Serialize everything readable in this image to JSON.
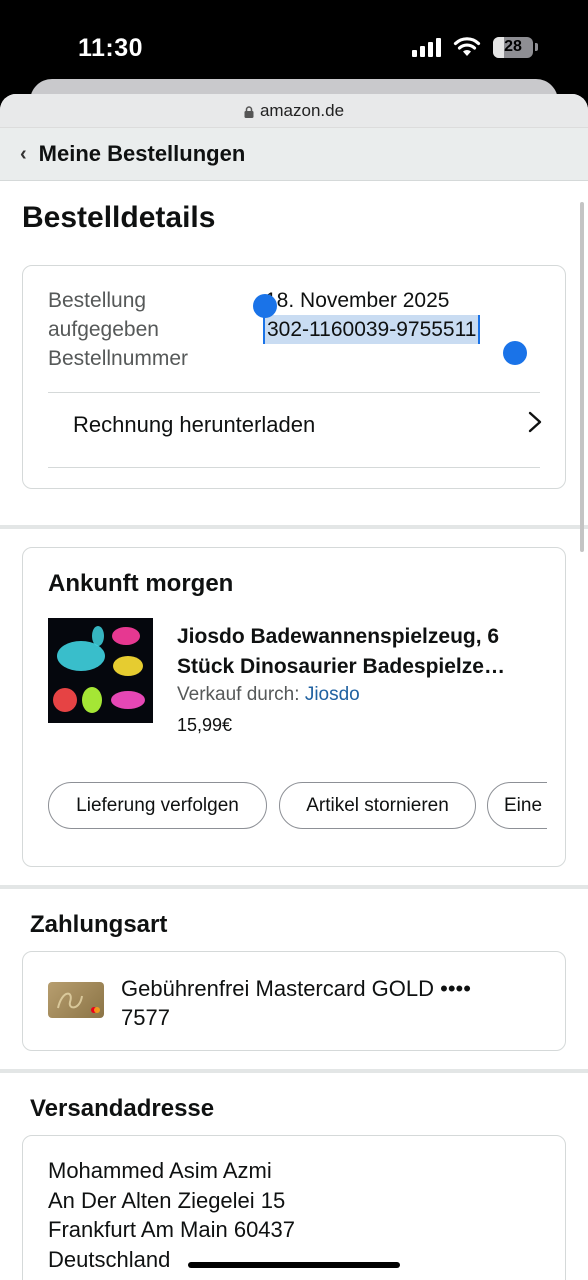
{
  "status": {
    "time": "11:30",
    "battery": "28",
    "battery_level": 0.28
  },
  "browser": {
    "url": "amazon.de"
  },
  "nav": {
    "back_label": "Meine Bestellungen"
  },
  "page_title": "Bestelldetails",
  "order": {
    "placed_label": "Bestellung aufgegeben",
    "number_label": "Bestellnummer",
    "placed_date": "18. November 2025",
    "order_number": "302-1160039-9755511",
    "invoice_label": "Rechnung herunterladen"
  },
  "shipment": {
    "title": "Ankunft morgen",
    "product_line1": "Jiosdo Badewannenspielzeug, 6",
    "product_line2": "Stück Dinosaurier Badespielze…",
    "sold_by_label": "Verkauf durch:",
    "seller": "Jiosdo",
    "price": "15,99€",
    "buttons": [
      "Lieferung verfolgen",
      "Artikel stornieren",
      "Eine"
    ]
  },
  "payment": {
    "title": "Zahlungsart",
    "method": "Gebührenfrei Mastercard GOLD ••••",
    "last4": "7577"
  },
  "shipping": {
    "title": "Versandadresse",
    "lines": [
      "Mohammed Asim Azmi",
      "An Der Alten Ziegelei 15",
      "Frankfurt Am Main 60437",
      "Deutschland"
    ]
  }
}
